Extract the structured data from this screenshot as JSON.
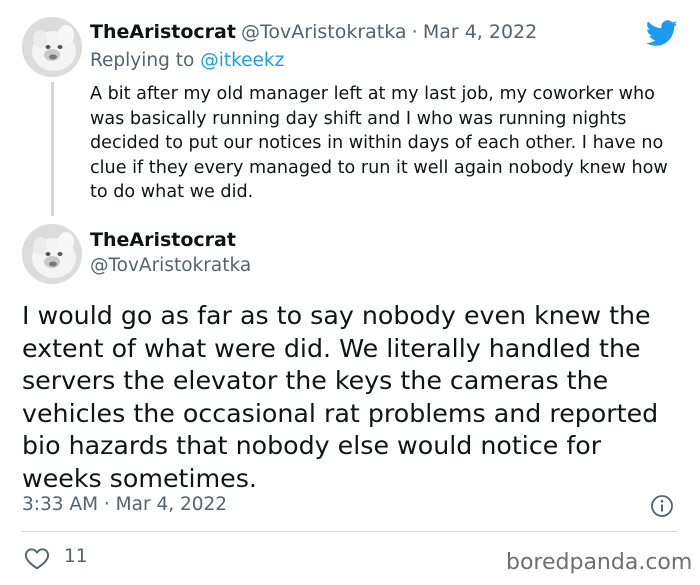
{
  "reply_tweet": {
    "author_name": "TheAristocrat",
    "author_handle": "@TovAristokratka",
    "separator": "·",
    "date": "Mar 4, 2022",
    "replying_prefix": "Replying to",
    "replying_to": "@itkeekz",
    "text": "A bit after my old manager left at my last job, my coworker who was basically running day shift and I who was running nights decided to put our notices in within days of each other. I have no clue if they every managed to run it well again nobody knew how to do what we did."
  },
  "main_tweet": {
    "author_name": "TheAristocrat",
    "author_handle": "@TovAristokratka",
    "text": "I would go as far as to say nobody even knew the extent of what were did. We literally handled the servers the elevator the keys the cameras the vehicles the occasional rat problems and reported bio hazards that nobody else would notice for weeks sometimes.",
    "timestamp": "3:33 AM · Mar 4, 2022",
    "like_count": "11"
  },
  "watermark": "boredpanda.com",
  "colors": {
    "twitter_blue": "#1d9bf0",
    "muted_text": "#536471",
    "divider": "#cfd9de"
  },
  "icons": {
    "brand": "twitter-bird-icon",
    "info": "info-icon",
    "like": "heart-icon"
  }
}
